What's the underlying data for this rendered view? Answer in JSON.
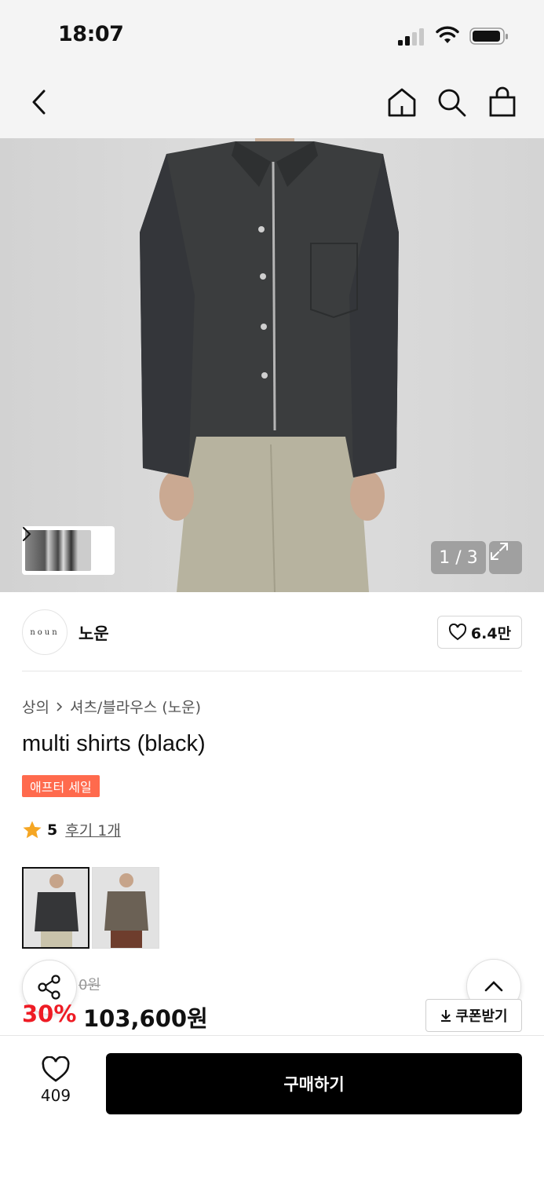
{
  "status_bar": {
    "time": "18:07"
  },
  "nav": {
    "back_icon": "chevron-left-icon",
    "home_icon": "home-icon",
    "search_icon": "search-icon",
    "cart_icon": "shopping-bag-icon"
  },
  "gallery": {
    "counter": "1 / 3",
    "expand_icon": "expand-icon",
    "thumbnail_next_icon": "chevron-right-icon"
  },
  "brand": {
    "logo_text": "noun",
    "name": "노운",
    "like_count": "6.4만"
  },
  "breadcrumb": {
    "category": "상의",
    "subcategory": "셔츠/블라우스 (노운)"
  },
  "product": {
    "title": "multi shirts (black)",
    "badge": "애프터 세일",
    "rating": "5",
    "reviews": "후기 1개",
    "old_price": "0원",
    "discount": "30%",
    "price": "103,600원",
    "coupon_label": "쿠폰받기"
  },
  "bottom_bar": {
    "wish_count": "409",
    "buy_label": "구매하기"
  },
  "colors": {
    "accent_red": "#ee1c25",
    "badge_orange": "#ff6a4d",
    "star_orange": "#f5a623"
  }
}
